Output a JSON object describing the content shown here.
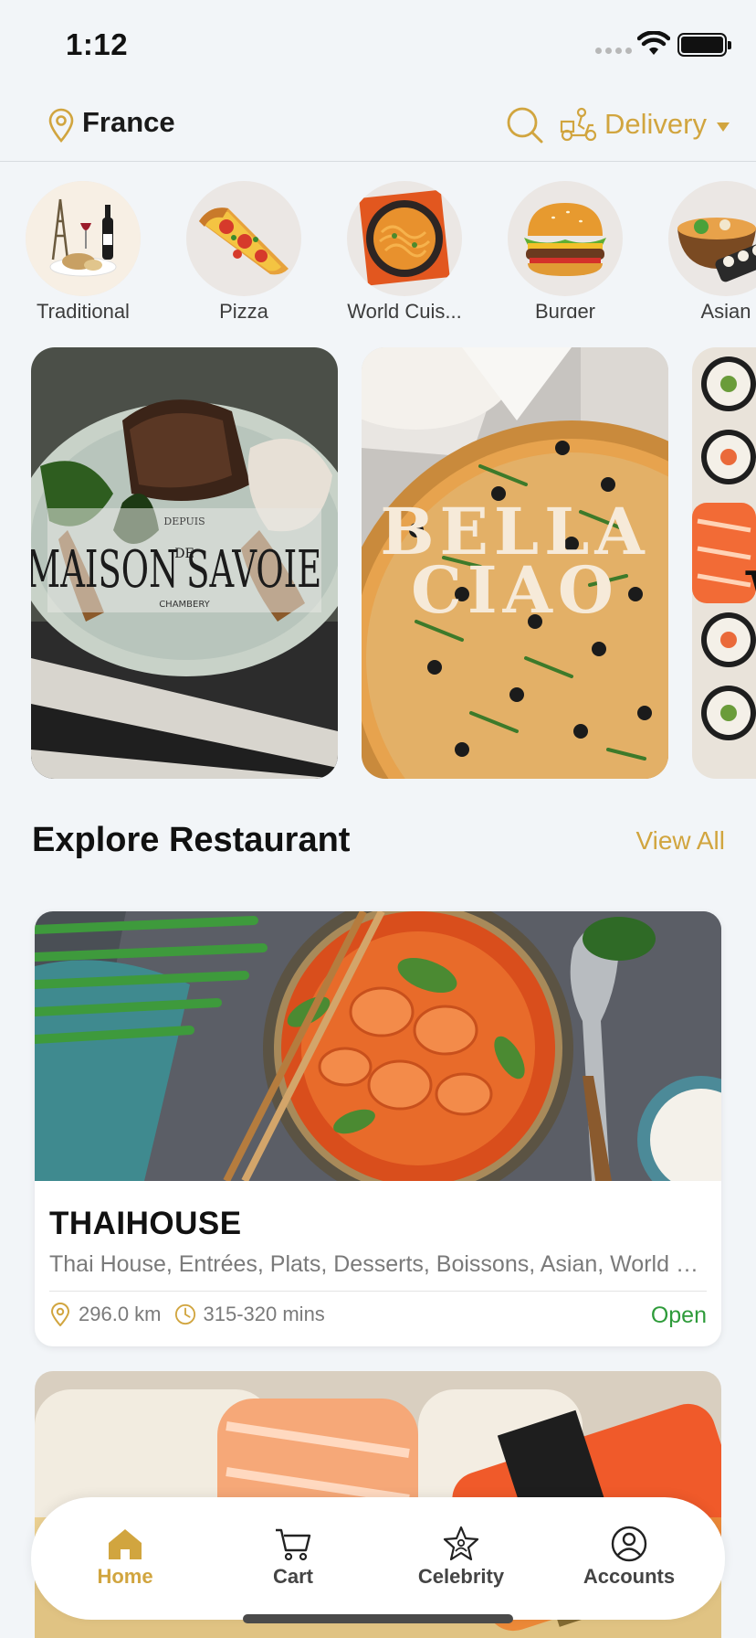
{
  "status_bar": {
    "time": "1:12"
  },
  "header": {
    "location": "France",
    "delivery_label": "Delivery"
  },
  "categories": [
    {
      "label": "Traditional",
      "icon": "traditional-food-icon"
    },
    {
      "label": "Pizza",
      "icon": "pizza-icon"
    },
    {
      "label": "World Cuis...",
      "icon": "noodles-icon"
    },
    {
      "label": "Burger",
      "icon": "burger-icon"
    },
    {
      "label": "Asian",
      "icon": "asian-food-icon"
    }
  ],
  "banners": [
    {
      "brand_main": "MAISON",
      "brand_small": "DE",
      "brand_main2": "SAVOIE",
      "brand_top": "DEPUIS",
      "brand_sub": "CHAMBERY"
    },
    {
      "brand_line1": "BELLA",
      "brand_line2": "CIAO"
    },
    {
      "brand_partial": "W"
    }
  ],
  "explore": {
    "title": "Explore Restaurant",
    "view_all": "View All"
  },
  "restaurants": [
    {
      "name": "THAIHOUSE",
      "cuisines": "Thai House, Entrées, Plats, Desserts, Boissons, Asian, World Cuisine",
      "distance": "296.0 km",
      "time": "315-320 mins",
      "status": "Open"
    }
  ],
  "bottom_nav": [
    {
      "label": "Home",
      "icon": "home-icon",
      "active": true
    },
    {
      "label": "Cart",
      "icon": "cart-icon",
      "active": false
    },
    {
      "label": "Celebrity",
      "icon": "star-icon",
      "active": false
    },
    {
      "label": "Accounts",
      "icon": "account-icon",
      "active": false
    }
  ],
  "colors": {
    "accent": "#d1a53f",
    "open": "#2e9b3a",
    "background": "#f2f5f8"
  }
}
